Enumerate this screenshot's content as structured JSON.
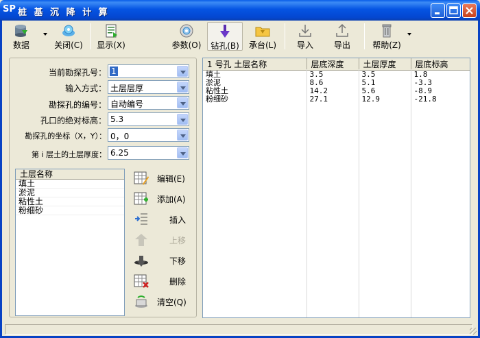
{
  "window": {
    "logo": "SP",
    "title": "桩 基 沉 降 计 算",
    "controls": [
      "minimize",
      "maximize",
      "close"
    ]
  },
  "toolbar": {
    "data": "数据",
    "close": "关闭(C)",
    "display": "显示(X)",
    "params": "参数(O)",
    "drill": "钻孔(B)",
    "cap": "承台(L)",
    "import": "导入",
    "export": "导出",
    "help": "帮助(Z)"
  },
  "form": {
    "current_hole_label": "当前勘探孔号：",
    "current_hole_value": "1",
    "input_mode_label": "输入方式：",
    "input_mode_value": "土层层厚",
    "hole_number_label": "勘探孔的编号：",
    "hole_number_value": "自动编号",
    "elevation_label": "孔口的绝对标高：",
    "elevation_value": "5.3",
    "coords_label": "勘探孔的坐标（X，Y）：",
    "coords_value": "0，0",
    "thickness_label": "第 i 层土的土层厚度：",
    "thickness_value": "6.25"
  },
  "layer_list": {
    "header": "土层名称",
    "items": [
      "填土",
      "淤泥",
      "粘性土",
      "粉细砂"
    ]
  },
  "side_buttons": {
    "edit": "编辑(E)",
    "add": "添加(A)",
    "insert": "插入",
    "move_up": "上移",
    "move_down": "下移",
    "delete": "删除",
    "clear": "清空(Q)"
  },
  "grid": {
    "columns": [
      "1 号孔 土层名称",
      "层底深度",
      "土层厚度",
      "层底标高"
    ],
    "rows": [
      [
        "填土",
        "3.5",
        "3.5",
        "1.8"
      ],
      [
        "淤泥",
        "8.6",
        "5.1",
        "-3.3"
      ],
      [
        "粘性土",
        "14.2",
        "5.6",
        "-8.9"
      ],
      [
        "粉细砂",
        "27.1",
        "12.9",
        "-21.8"
      ]
    ]
  }
}
